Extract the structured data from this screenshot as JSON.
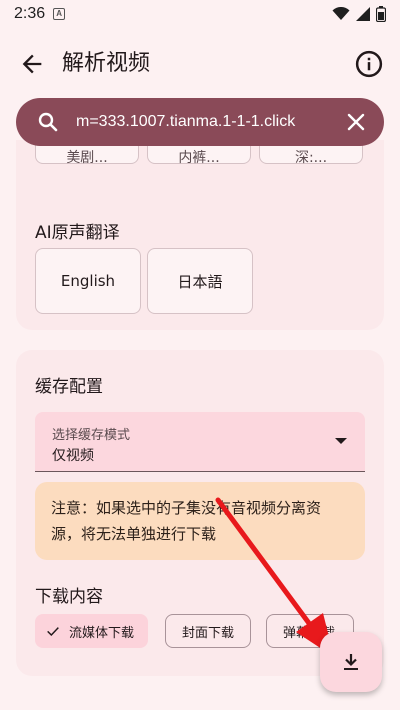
{
  "status": {
    "time": "2:36",
    "sim": "A"
  },
  "appbar": {
    "title": "解析视频"
  },
  "search": {
    "value": "m=333.1007.tianma.1-1-1.click"
  },
  "top_buttons": [
    "美剧...",
    "内裤...",
    "深:..."
  ],
  "ai_translate": {
    "label": "AI原声翻译",
    "options": [
      "English",
      "日本語"
    ]
  },
  "cache": {
    "title": "缓存配置",
    "select_label": "选择缓存模式",
    "select_value": "仅视频",
    "notice": "注意：如果选中的子集没有音视频分离资源，将无法单独进行下载"
  },
  "download": {
    "title": "下载内容",
    "chips": [
      {
        "label": "流媒体下载",
        "selected": true
      },
      {
        "label": "封面下载",
        "selected": false
      },
      {
        "label": "弹幕下载",
        "selected": false
      }
    ]
  },
  "colors": {
    "accent": "#8a4a58",
    "arrow": "#e8191c",
    "notice_bg": "#fcdcbf"
  }
}
